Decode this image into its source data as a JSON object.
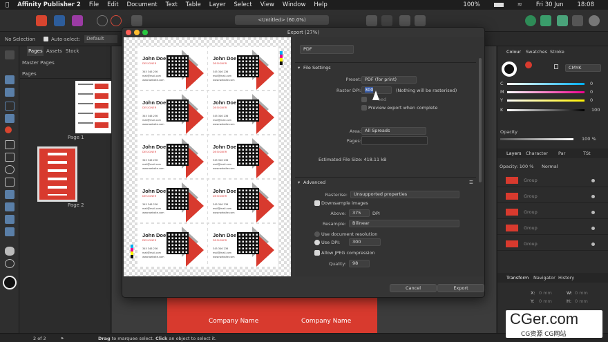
{
  "menubar": {
    "app": "Affinity Publisher 2",
    "items": [
      "File",
      "Edit",
      "Document",
      "Text",
      "Table",
      "Layer",
      "Select",
      "View",
      "Window",
      "Help"
    ],
    "battery": "100%",
    "date": "Fri 30 Jun",
    "time": "18:08"
  },
  "toolbar": {
    "doc_tab": "<Untitled> (60.0%)"
  },
  "context": {
    "selection": "No Selection",
    "autoselect": "Auto-select:",
    "default": "Default"
  },
  "pages_panel": {
    "tabs": [
      "Pages",
      "Assets",
      "Stock"
    ],
    "master": "Master Pages",
    "pages": "Pages",
    "page1": "Page 1",
    "page2": "Page 2"
  },
  "dialog": {
    "title": "Export (27%)",
    "format": "PDF",
    "file_settings": "File Settings",
    "preset_label": "Preset:",
    "preset": "PDF (for print)",
    "dpi_label": "Raster DPI:",
    "dpi": "300",
    "dpi_note": "(Nothing will be rasterised)",
    "embed_partial": "eed",
    "preview_export": "Preview export when complete",
    "area_label": "Area:",
    "area": "All Spreads",
    "pages_label": "Pages:",
    "filesize": "Estimated File Size: 418.11 kB",
    "advanced": "Advanced",
    "rasterise_label": "Rasterise:",
    "rasterise": "Unsupported properties",
    "downsample": "Downsample images",
    "above_label": "Above:",
    "above": "375",
    "dpi_unit": "DPI",
    "resample_label": "Resample:",
    "resample": "Bilinear",
    "use_doc_res": "Use document resolution",
    "use_dpi": "Use DPI:",
    "use_dpi_val": "300",
    "allow_jpeg": "Allow JPEG compression",
    "quality_label": "Quality:",
    "quality": "98",
    "cancel": "Cancel",
    "export": "Export"
  },
  "card": {
    "name": "John Doe",
    "title": "DESIGNER",
    "phone": "345 346 236",
    "mail": "mail@mail.com",
    "web": "www.website.com"
  },
  "right": {
    "tabs1": [
      "Colour",
      "Swatches",
      "Stroke"
    ],
    "mode": "CMYK",
    "c": "C",
    "m": "M",
    "y": "Y",
    "k": "K",
    "cv": "0",
    "mv": "0",
    "yv": "0",
    "kv": "100",
    "opacity": "Opacity",
    "opv": "100 %",
    "tabs2": [
      "Layers",
      "Character",
      "Par",
      "TSt"
    ],
    "op_label": "Opacity: 100 %",
    "blend": "Normal",
    "group": "Group",
    "tabs3": [
      "Transform",
      "Navigator",
      "History"
    ],
    "x": "X:",
    "y2": "Y:",
    "w": "W:",
    "h": "H:",
    "zero": "0 mm"
  },
  "canvas": {
    "company": "Company Name"
  },
  "status": {
    "pages": "2 of 2",
    "hint_b1": "Drag",
    "hint1": " to marquee select. ",
    "hint_b2": "Click",
    "hint2": " an object to select it."
  },
  "watermark": {
    "line1": "CGer.com",
    "line2": "CG资源 CG网站"
  }
}
